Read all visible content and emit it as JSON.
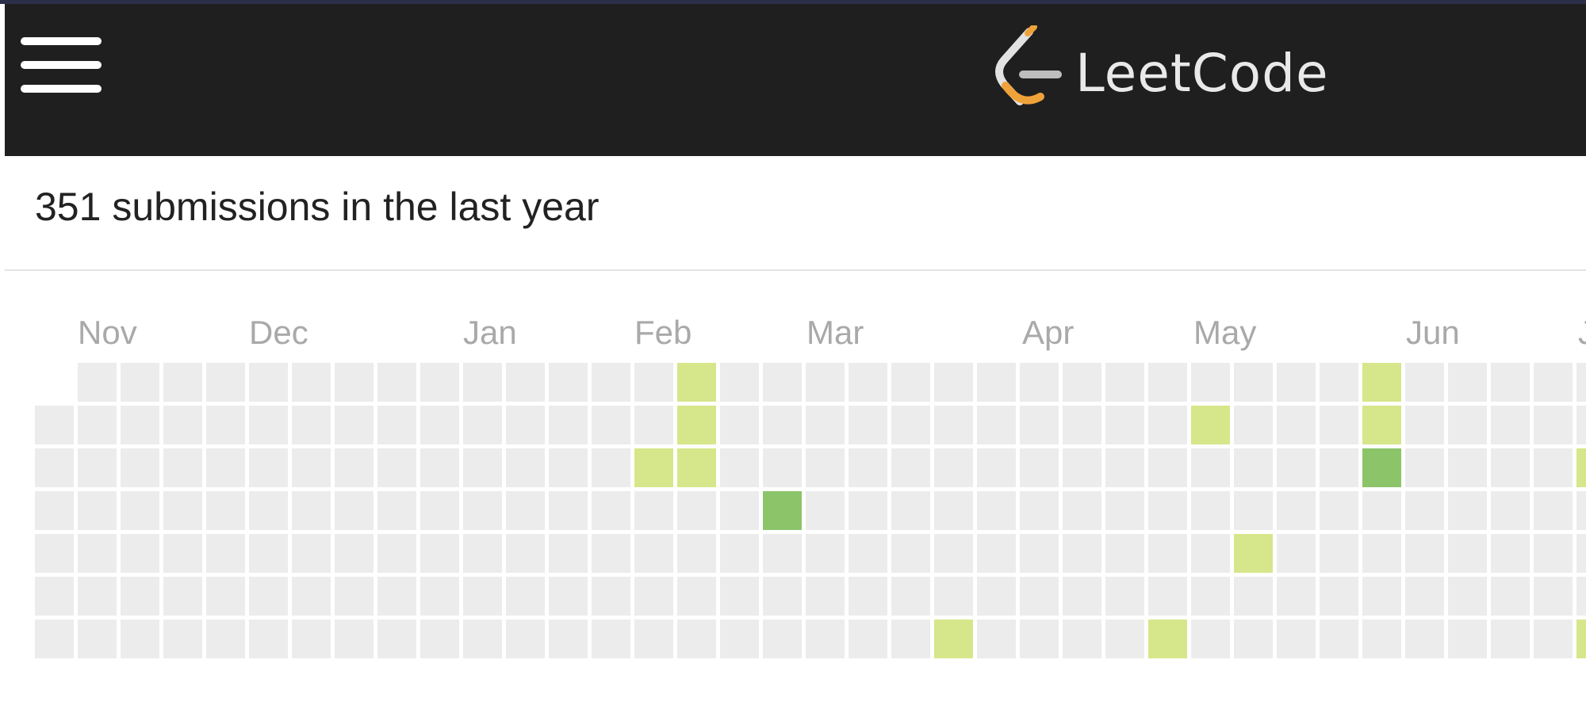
{
  "navbar": {
    "menu_icon": "hamburger-menu-icon",
    "brand_name": "LeetCode",
    "brand_icon": "leetcode-logo-icon",
    "background": "#1f1f1f"
  },
  "summary": {
    "text": "351 submissions in the last year"
  },
  "calendar": {
    "months": [
      "Nov",
      "Dec",
      "Jan",
      "Feb",
      "Mar",
      "Apr",
      "May",
      "Jun",
      "J"
    ],
    "colors": {
      "empty": "#ececec",
      "level1": "#d6e68a",
      "level2": "#8cc46a"
    },
    "highlighted_cells": [
      {
        "week": 15,
        "day": 0,
        "level": 1
      },
      {
        "week": 15,
        "day": 1,
        "level": 1
      },
      {
        "week": 14,
        "day": 2,
        "level": 1
      },
      {
        "week": 15,
        "day": 2,
        "level": 1
      },
      {
        "week": 17,
        "day": 3,
        "level": 2
      },
      {
        "week": 21,
        "day": 6,
        "level": 1
      },
      {
        "week": 27,
        "day": 1,
        "level": 1
      },
      {
        "week": 26,
        "day": 6,
        "level": 1
      },
      {
        "week": 28,
        "day": 4,
        "level": 1
      },
      {
        "week": 31,
        "day": 0,
        "level": 1
      },
      {
        "week": 31,
        "day": 1,
        "level": 1
      },
      {
        "week": 31,
        "day": 2,
        "level": 2
      },
      {
        "week": 36,
        "day": 2,
        "level": 1
      },
      {
        "week": 36,
        "day": 6,
        "level": 1
      }
    ]
  }
}
